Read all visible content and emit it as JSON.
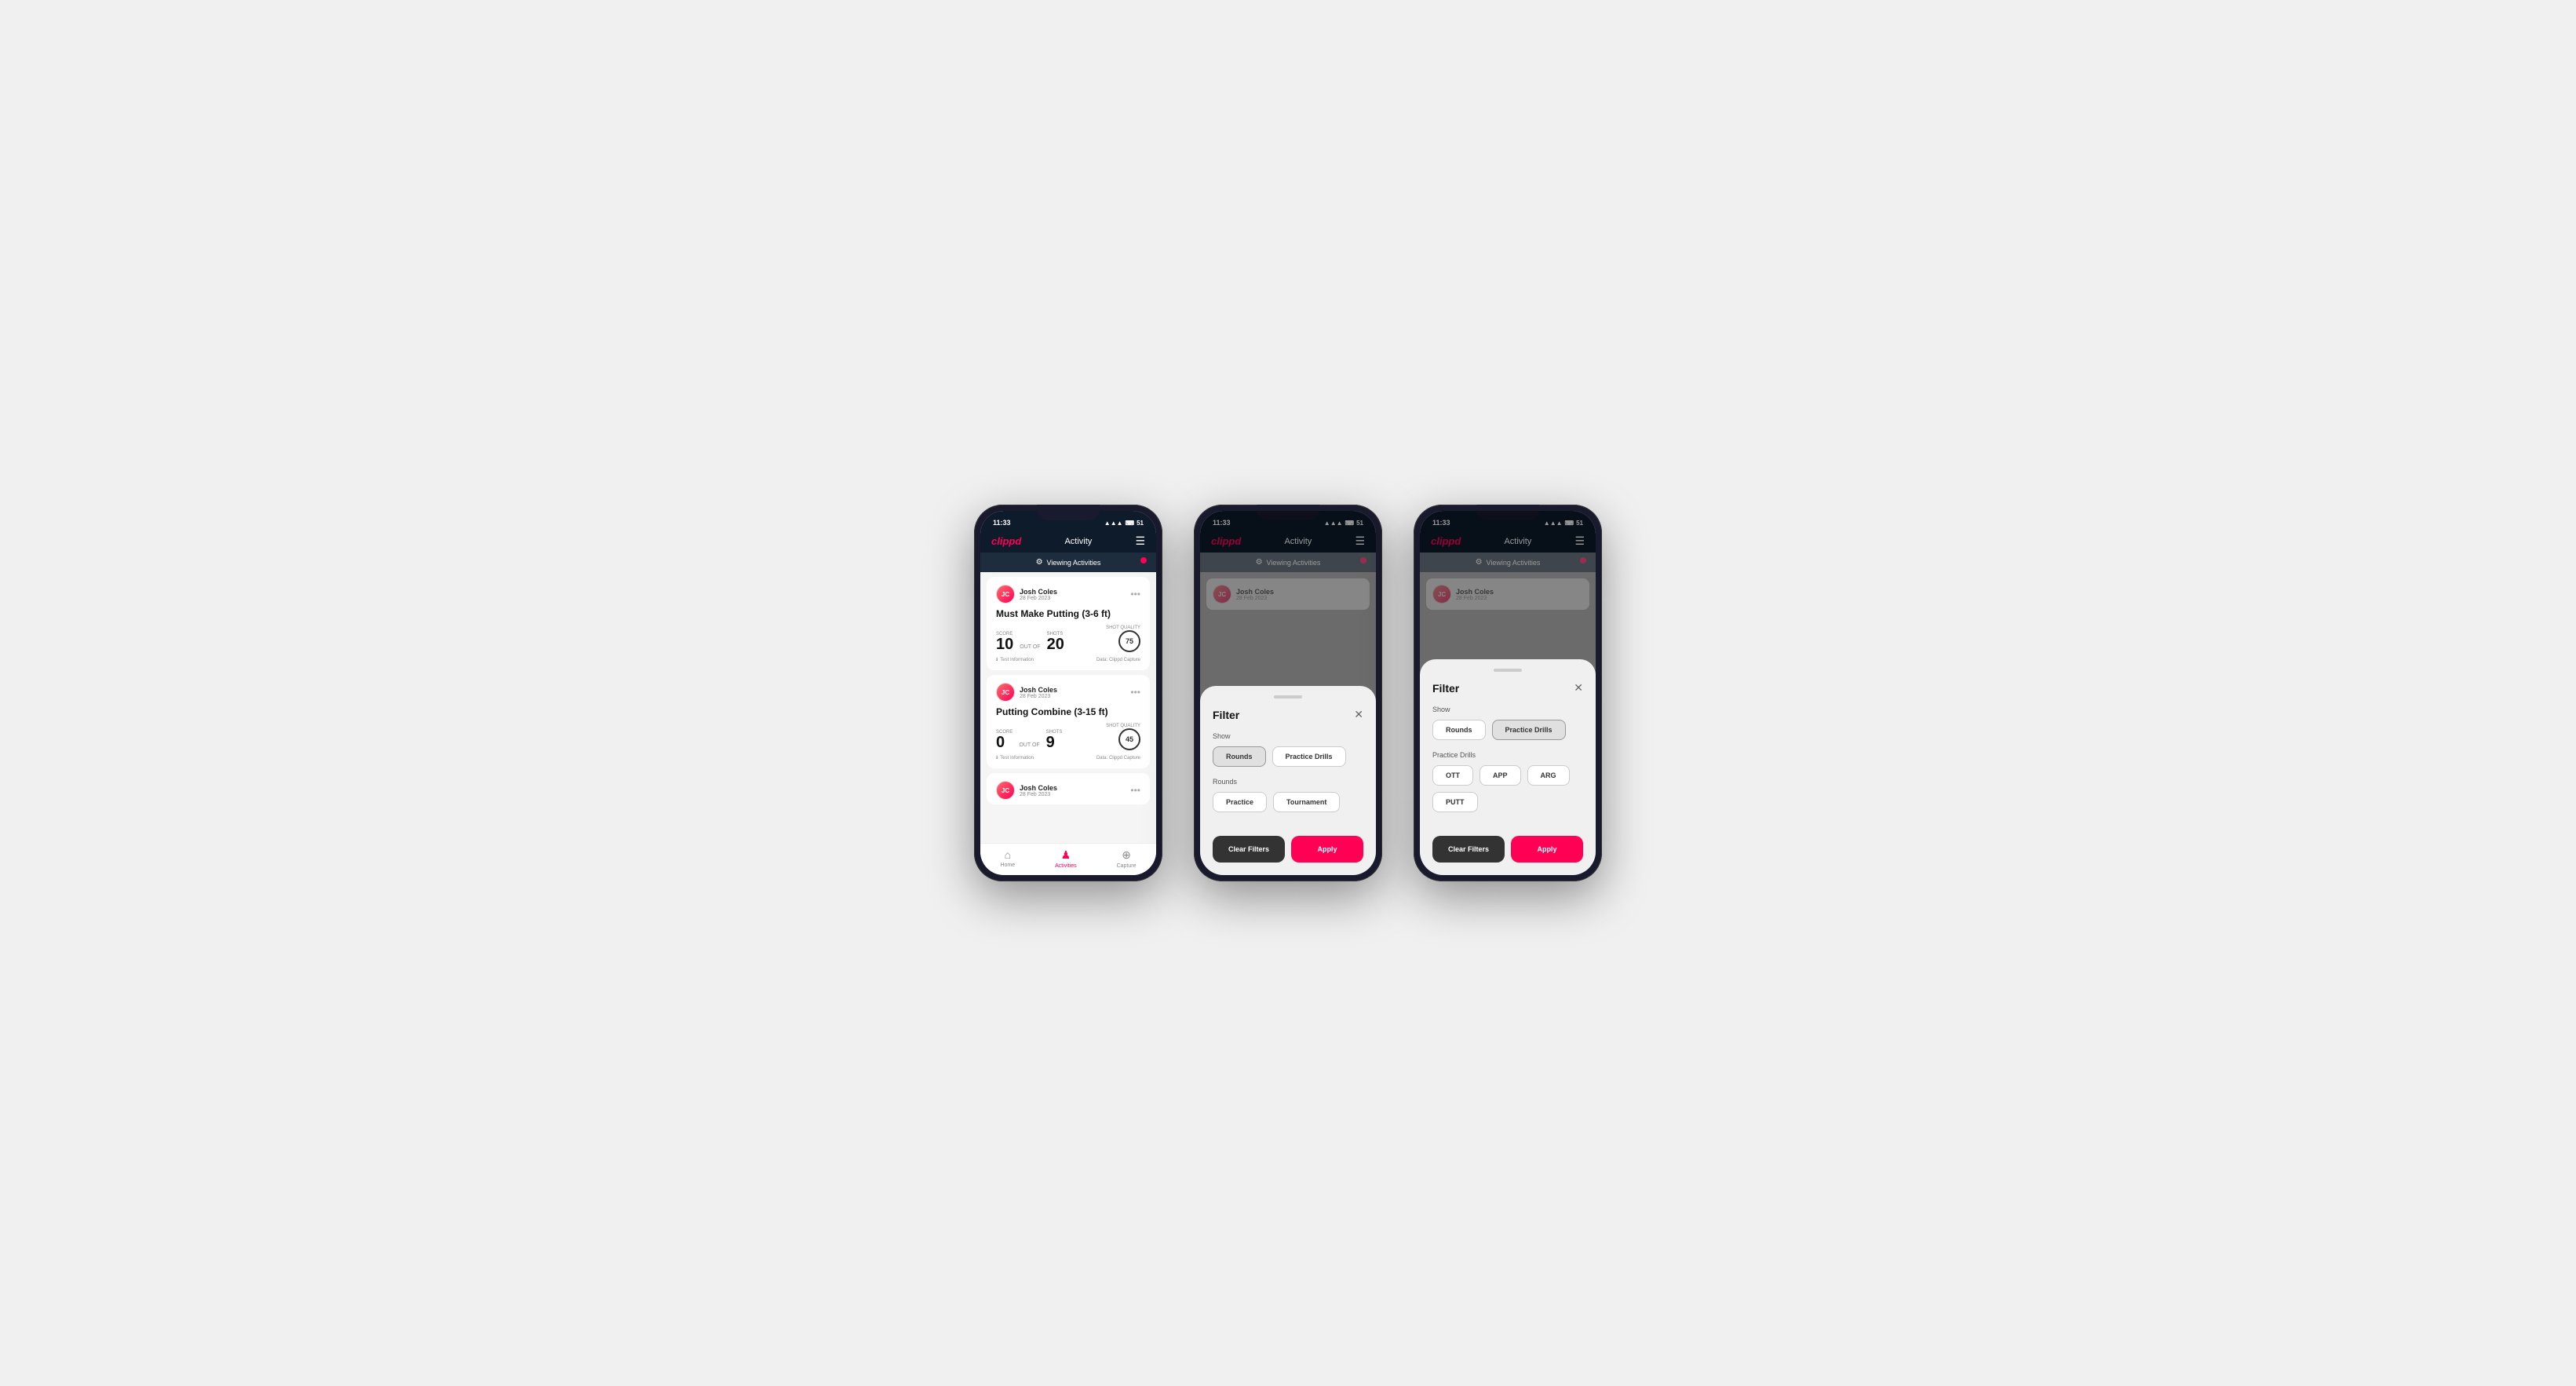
{
  "screens": [
    {
      "id": "screen1",
      "status": {
        "time": "11:33",
        "battery": "51"
      },
      "nav": {
        "logo": "clippd",
        "title": "Activity",
        "menu": "☰"
      },
      "viewing_bar": {
        "label": "Viewing Activities",
        "icon": "⚙"
      },
      "activities": [
        {
          "user": "Josh Coles",
          "date": "28 Feb 2023",
          "title": "Must Make Putting (3-6 ft)",
          "score_label": "Score",
          "score": "10",
          "out_of": "OUT OF",
          "shots_label": "Shots",
          "shots": "20",
          "shot_quality_label": "Shot Quality",
          "shot_quality": "75",
          "test_info": "Test Information",
          "data_source": "Data: Clippd Capture"
        },
        {
          "user": "Josh Coles",
          "date": "28 Feb 2023",
          "title": "Putting Combine (3-15 ft)",
          "score_label": "Score",
          "score": "0",
          "out_of": "OUT OF",
          "shots_label": "Shots",
          "shots": "9",
          "shot_quality_label": "Shot Quality",
          "shot_quality": "45",
          "test_info": "Test Information",
          "data_source": "Data: Clippd Capture"
        }
      ],
      "partial_card": {
        "user": "Josh Coles",
        "date": "28 Feb 2023"
      },
      "tabs": [
        {
          "id": "home",
          "label": "Home",
          "icon": "⌂",
          "active": false
        },
        {
          "id": "activities",
          "label": "Activities",
          "icon": "♟",
          "active": true
        },
        {
          "id": "capture",
          "label": "Capture",
          "icon": "⊕",
          "active": false
        }
      ]
    },
    {
      "id": "screen2",
      "status": {
        "time": "11:33",
        "battery": "51"
      },
      "nav": {
        "logo": "clippd",
        "title": "Activity",
        "menu": "☰"
      },
      "viewing_bar": {
        "label": "Viewing Activities",
        "icon": "⚙"
      },
      "filter": {
        "title": "Filter",
        "show_label": "Show",
        "show_buttons": [
          {
            "label": "Rounds",
            "active": true
          },
          {
            "label": "Practice Drills",
            "active": false
          }
        ],
        "rounds_label": "Rounds",
        "rounds_buttons": [
          {
            "label": "Practice",
            "active": false
          },
          {
            "label": "Tournament",
            "active": false
          }
        ],
        "clear_label": "Clear Filters",
        "apply_label": "Apply"
      }
    },
    {
      "id": "screen3",
      "status": {
        "time": "11:33",
        "battery": "51"
      },
      "nav": {
        "logo": "clippd",
        "title": "Activity",
        "menu": "☰"
      },
      "viewing_bar": {
        "label": "Viewing Activities",
        "icon": "⚙"
      },
      "filter": {
        "title": "Filter",
        "show_label": "Show",
        "show_buttons": [
          {
            "label": "Rounds",
            "active": false
          },
          {
            "label": "Practice Drills",
            "active": true
          }
        ],
        "practice_drills_label": "Practice Drills",
        "drill_buttons": [
          {
            "label": "OTT",
            "active": false
          },
          {
            "label": "APP",
            "active": false
          },
          {
            "label": "ARG",
            "active": false
          },
          {
            "label": "PUTT",
            "active": false
          }
        ],
        "clear_label": "Clear Filters",
        "apply_label": "Apply"
      }
    }
  ]
}
